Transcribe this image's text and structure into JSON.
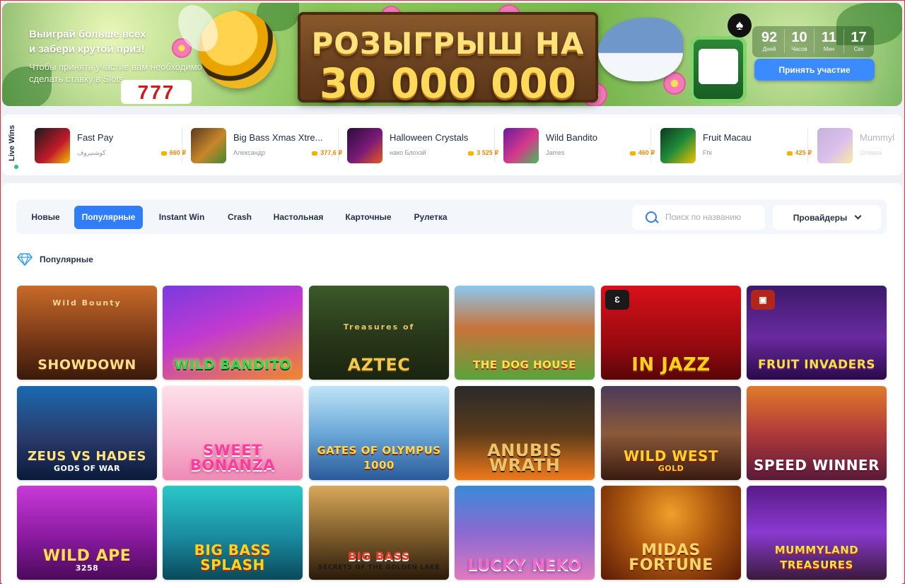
{
  "hero": {
    "title_line1": "Выиграй больше всех",
    "title_line2": "и забери крутой приз!",
    "subtitle_line1": "Чтобы принять участие вам необходимо",
    "subtitle_line2": "сделать ставку в Slots",
    "board_line1": "РОЗЫГРЫШ НА",
    "board_line2": "30 000 000",
    "slot_text": "777",
    "countdown": [
      {
        "value": "92",
        "label": "Дней"
      },
      {
        "value": "10",
        "label": "Часов"
      },
      {
        "value": "11",
        "label": "Мин"
      },
      {
        "value": "17",
        "label": "Сек"
      }
    ],
    "join_label": "Принять участие"
  },
  "live_wins": {
    "label": "Live Wins",
    "items": [
      {
        "game": "Fast Pay",
        "user": "كوشنيروف",
        "amount": "660 ₽"
      },
      {
        "game": "Big Bass Xmas Xtre...",
        "user": "Александр",
        "amount": "377,6 ₽"
      },
      {
        "game": "Halloween Crystals",
        "user": "нако Блохэй",
        "amount": "3 525 ₽"
      },
      {
        "game": "Wild Bandito",
        "user": "James",
        "amount": "460 ₽"
      },
      {
        "game": "Fruit Macau",
        "user": "Fhi",
        "amount": "425 ₽"
      },
      {
        "game": "Mummyl",
        "user": "Оливка",
        "amount": ""
      }
    ]
  },
  "tabs": [
    "Новые",
    "Популярные",
    "Instant Win",
    "Crash",
    "Настольная",
    "Карточные",
    "Рулетка"
  ],
  "active_tab": "Популярные",
  "search": {
    "placeholder": "Поиск по названию"
  },
  "providers_label": "Провайдеры",
  "section_title": "Популярные",
  "games": [
    {
      "title": "Showdown",
      "sub": "Wild Bounty"
    },
    {
      "title": "Wild Bandito",
      "sub": ""
    },
    {
      "title": "Aztec",
      "sub": "Treasures of"
    },
    {
      "title": "The Dog House",
      "sub": ""
    },
    {
      "title": "In Jazz",
      "sub": ""
    },
    {
      "title": "Fruit Invaders",
      "sub": ""
    },
    {
      "title": "Zeus vs Hades",
      "sub": "Gods of War"
    },
    {
      "title": "Sweet Bonanza",
      "sub": ""
    },
    {
      "title": "Gates of Olympus 1000",
      "sub": ""
    },
    {
      "title": "Anubis Wrath",
      "sub": ""
    },
    {
      "title": "Wild West",
      "sub": "Gold"
    },
    {
      "title": "Speed Winner",
      "sub": ""
    },
    {
      "title": "Wild Ape",
      "sub": "3258"
    },
    {
      "title": "Big Bass Splash",
      "sub": ""
    },
    {
      "title": "Big Bass",
      "sub": "Secrets of The Golden Lake"
    },
    {
      "title": "Lucky Neko",
      "sub": ""
    },
    {
      "title": "Midas Fortune",
      "sub": ""
    },
    {
      "title": "Mummyland Treasures",
      "sub": ""
    }
  ],
  "colors": {
    "accent": "#2f7ef5",
    "amount": "#f08a00",
    "live_dot": "#28c76f"
  }
}
